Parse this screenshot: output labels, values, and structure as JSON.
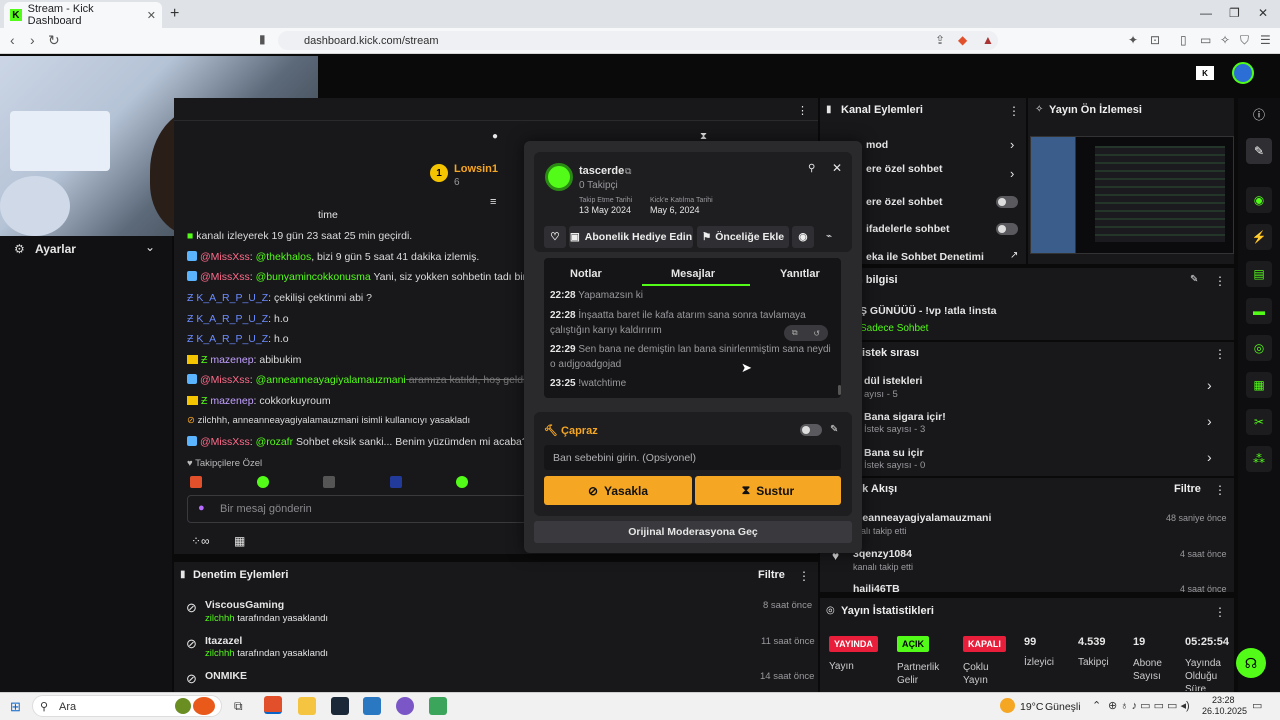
{
  "browser": {
    "tab_title": "Stream - Kick Dashboard",
    "url": "dashboard.kick.com/stream"
  },
  "left": {
    "settings_label": "Ayarlar"
  },
  "chat": {
    "top_user": "Lowsin1",
    "top_user_badge": "1",
    "top_user_count": "6",
    "time_header_suffix": "time",
    "messages": [
      {
        "user": "",
        "text": "kanalı izleyerek 19 gün 23 saat 25 min geçirdi."
      },
      {
        "user": "@MissXss",
        "mention": "@thekhalos",
        "text": ", bizi 9 gün 5 saat 41 dakika izlemiş."
      },
      {
        "user": "@MissXss",
        "mention": "@bunyamincokkonusma",
        "text": " Yani, siz yokken sohbetin tadı bir başka o"
      },
      {
        "user": "K_A_R_P_U_Z",
        "text": ": çekilişi çektinmi abi ?"
      },
      {
        "user": "K_A_R_P_U_Z",
        "text": ": h.o"
      },
      {
        "user": "K_A_R_P_U_Z",
        "text": ": h.o"
      },
      {
        "user": "mazenep",
        "text": ": abibukim"
      },
      {
        "user": "@MissXss",
        "mention": "@anneanneayagiyalamauzmani",
        "text": " aramıza katıldı, hoş geldin! Artık"
      },
      {
        "user": "mazenep",
        "text": ": cokkorkuyroum"
      },
      {
        "user": "zilchhh",
        "text": ", anneanneayagiyalamauzmani isimli kullanıcıyı yasakladı"
      },
      {
        "user": "@MissXss",
        "mention": "@rozafr",
        "text": " Sohbet eksik sanki... Benim yüzümden mi acaba? Sizin bi"
      }
    ],
    "followers_only": "Takipçilere Özel",
    "input_placeholder": "Bir mesaj gönderin"
  },
  "popup": {
    "username": "tascerde",
    "followers": "0 Takipçi",
    "follow_date_label": "Takip Etme Tarihi",
    "follow_date": "13 May 2024",
    "join_date_label": "Kick'e Katılma Tarihi",
    "join_date": "May 6, 2024",
    "gift_btn": "Abonelik Hediye Edin",
    "priority_btn": "Önceliğe Ekle",
    "tabs": [
      "Notlar",
      "Mesajlar",
      "Yanıtlar"
    ],
    "messages": [
      {
        "time": "22:28",
        "text": "Yapamazsın ki"
      },
      {
        "time": "22:28",
        "text": "İnşaatta baret ile kafa atarım sana sonra tavlamaya çalıştığın karıyı kaldırırım"
      },
      {
        "time": "22:29",
        "text": "Sen bana ne demiştin lan bana sinirlenmiştim sana neydi o aıdjgoadgojad"
      },
      {
        "time": "23:25",
        "text": "!watchtime"
      }
    ],
    "section_title": "Çapraz",
    "ban_placeholder": "Ban sebebini girin. (Opsiyonel)",
    "ban_btn": "Yasakla",
    "mute_btn": "Sustur",
    "original_mod": "Orijinal Moderasyona Geç"
  },
  "mod_actions": {
    "title": "Denetim Eylemleri",
    "filter": "Filtre",
    "items": [
      {
        "user": "ViscousGaming",
        "by": "zilchhh",
        "suffix": "tarafından yasaklandı",
        "time": "8 saat önce"
      },
      {
        "user": "Itazazel",
        "by": "zilchhh",
        "suffix": "tarafından yasaklandı",
        "time": "11 saat önce"
      },
      {
        "user": "ONMIKE",
        "by": "",
        "suffix": "",
        "time": "14 saat önce"
      }
    ]
  },
  "channel_actions": {
    "title": "Kanal Eylemleri",
    "items": [
      "mod",
      "ere özel sohbet",
      "ere özel sohbet",
      "ifadelerle sohbet",
      "eka ile Sohbet Denetimi"
    ]
  },
  "preview": {
    "title": "Yayın Ön İzlemesi"
  },
  "stream_info": {
    "title": "n bilgisi",
    "stream_title": "Ş GÜNÜÜÜ - !vp !atla !insta",
    "category": "Sadece Sohbet"
  },
  "request_queue": {
    "title": "istek sırası",
    "items": [
      {
        "name": "dül istekleri",
        "count": "ayısı - 5"
      },
      {
        "name": "Bana sigara içir!",
        "count": "İstek sayısı - 3"
      },
      {
        "name": "Bana su içir",
        "count": "İstek sayısı - 0"
      }
    ]
  },
  "activity": {
    "title": "lik Akışı",
    "filter": "Filtre",
    "items": [
      {
        "user": "neanneayagiyalamauzmani",
        "text": "nalı takip etti",
        "time": "48 saniye önce"
      },
      {
        "user": "3qenzy1084",
        "text": "kanalı takip etti",
        "time": "4 saat önce"
      },
      {
        "user": "haili46TB",
        "text": "",
        "time": "4 saat önce"
      }
    ]
  },
  "stats": {
    "title": "Yayın İstatistikleri",
    "badges": [
      {
        "value": "YAYINDA",
        "label": "Yayın"
      },
      {
        "value": "AÇIK",
        "label": "Partnerlik Gelir"
      },
      {
        "value": "KAPALI",
        "label": "Çoklu Yayın"
      }
    ],
    "nums": [
      {
        "value": "99",
        "label": "İzleyici"
      },
      {
        "value": "4.539",
        "label": "Takipçi"
      },
      {
        "value": "19",
        "label": "Abone Sayısı"
      },
      {
        "value": "05:25:54",
        "label": "Yayında Olduğu Süre"
      }
    ]
  },
  "taskbar": {
    "search": "Ara",
    "weather": "19°C",
    "weather_desc": "Güneşli",
    "time": "23:28",
    "date": "26.10.2025"
  }
}
